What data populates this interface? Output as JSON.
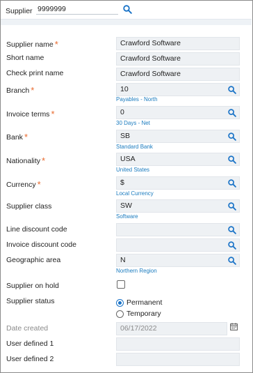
{
  "header": {
    "supplier_label": "Supplier",
    "supplier_value": "9999999"
  },
  "form": {
    "supplier_name": {
      "label": "Supplier name",
      "value": "Crawford Software"
    },
    "short_name": {
      "label": "Short name",
      "value": "Crawford Software"
    },
    "check_print_name": {
      "label": "Check print name",
      "value": "Crawford Software"
    },
    "branch": {
      "label": "Branch",
      "value": "10",
      "hint": "Payables - North"
    },
    "invoice_terms": {
      "label": "Invoice terms",
      "value": "0",
      "hint": "30 Days - Net"
    },
    "bank": {
      "label": "Bank",
      "value": "SB",
      "hint": "Standard Bank"
    },
    "nationality": {
      "label": "Nationality",
      "value": "USA",
      "hint": "United States"
    },
    "currency": {
      "label": "Currency",
      "value": "$",
      "hint": "Local Currency"
    },
    "supplier_class": {
      "label": "Supplier class",
      "value": "SW",
      "hint": "Software"
    },
    "line_discount_code": {
      "label": "Line discount code",
      "value": ""
    },
    "invoice_discount_code": {
      "label": "Invoice discount code",
      "value": ""
    },
    "geographic_area": {
      "label": "Geographic area",
      "value": "N",
      "hint": "Northern Region"
    },
    "supplier_on_hold": {
      "label": "Supplier on hold",
      "checked": false
    },
    "supplier_status": {
      "label": "Supplier status",
      "options": [
        "Permanent",
        "Temporary"
      ],
      "selected": "Permanent"
    },
    "date_created": {
      "label": "Date created",
      "value": "06/17/2022"
    },
    "user_defined_1": {
      "label": "User defined 1",
      "value": ""
    },
    "user_defined_2": {
      "label": "User defined 2",
      "value": ""
    }
  },
  "required_marker": "*",
  "colors": {
    "accent": "#1a73c7",
    "required": "#e96a2e",
    "hint": "#1a7bbf",
    "field_bg": "#eef1f4"
  }
}
